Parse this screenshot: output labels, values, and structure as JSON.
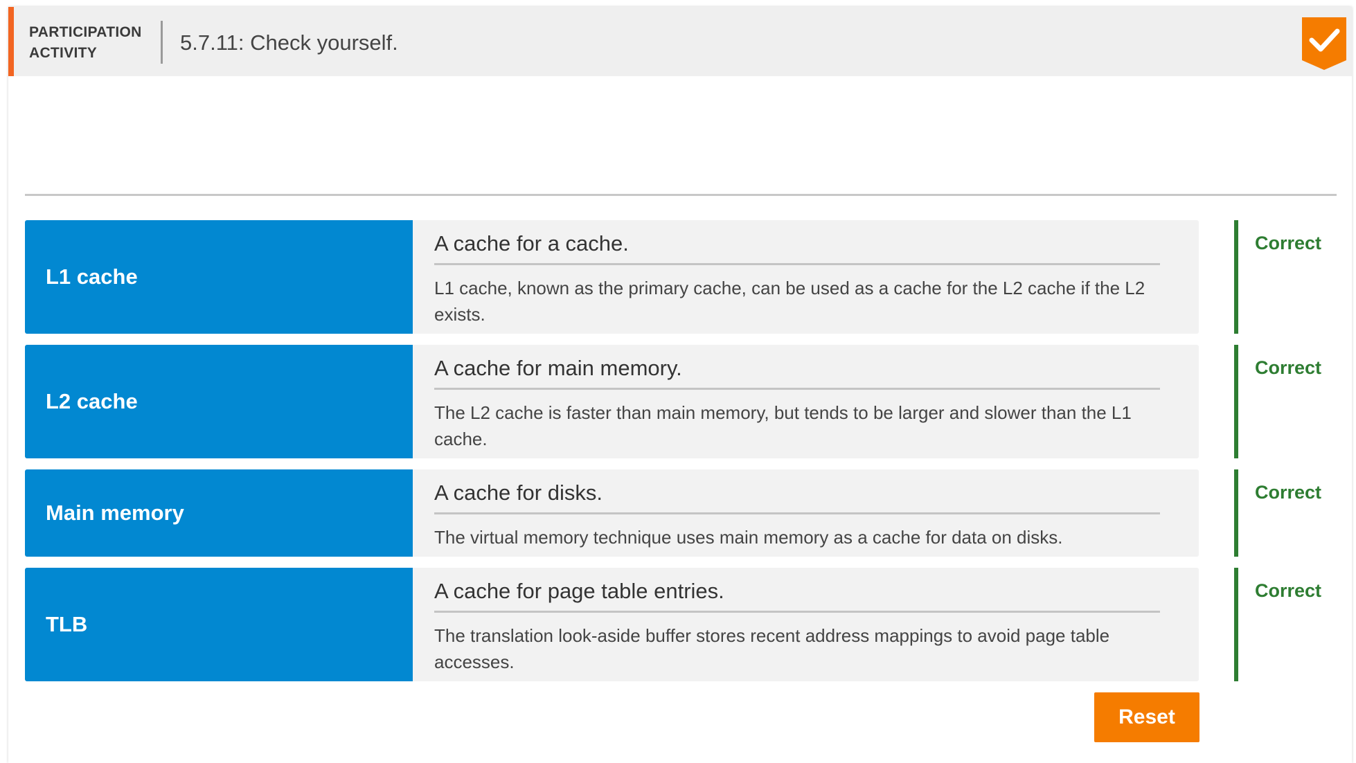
{
  "header": {
    "label": "PARTICIPATION\nACTIVITY",
    "title": "5.7.11: Check yourself.",
    "accent_color": "#f26522",
    "badge_icon": "check-icon",
    "badge_color": "#f57c00"
  },
  "matches": [
    {
      "term": "L1 cache",
      "definition": "A cache for a cache.",
      "explanation": "L1 cache, known as the primary cache, can be used as a cache for the L2 cache if the L2 exists.",
      "status": "Correct"
    },
    {
      "term": "L2 cache",
      "definition": "A cache for main memory.",
      "explanation": "The L2 cache is faster than main memory, but tends to be larger and slower than the L1 cache.",
      "status": "Correct"
    },
    {
      "term": "Main memory",
      "definition": "A cache for disks.",
      "explanation": "The virtual memory technique uses main memory as a cache for data on disks.",
      "status": "Correct"
    },
    {
      "term": "TLB",
      "definition": "A cache for page table entries.",
      "explanation": "The translation look-aside buffer stores recent address mappings to avoid page table accesses.",
      "status": "Correct"
    }
  ],
  "colors": {
    "term_bg": "#0288d1",
    "correct": "#2e7d32",
    "reset_bg": "#f57c00"
  },
  "reset_label": "Reset"
}
